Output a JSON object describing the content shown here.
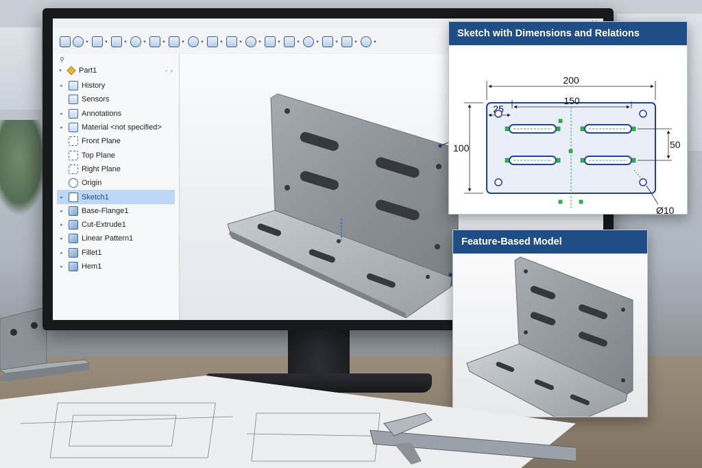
{
  "window": {
    "controls": [
      "–",
      "✕"
    ]
  },
  "toolbar": {
    "icons": [
      "home-icon",
      "new-doc-icon",
      "open-icon",
      "save-icon",
      "print-icon",
      "undo-icon",
      "rebuild-icon",
      "options-icon",
      "select-icon",
      "zoom-icon",
      "view-orient-icon",
      "display-style-icon",
      "hide-show-icon",
      "appearance-icon",
      "scene-icon",
      "section-icon",
      "measure-icon"
    ]
  },
  "feature_tree": {
    "filter_icon": "filter-icon",
    "root_label": "Part1",
    "items": [
      {
        "label": "History",
        "icon": "history-folder-icon",
        "expand": "▸",
        "kind": "folder"
      },
      {
        "label": "Sensors",
        "icon": "sensors-folder-icon",
        "expand": "",
        "kind": "folder"
      },
      {
        "label": "Annotations",
        "icon": "annotations-folder-icon",
        "expand": "▸",
        "kind": "folder"
      },
      {
        "label": "Material <not specified>",
        "icon": "material-icon",
        "expand": "▸",
        "kind": "folder"
      },
      {
        "label": "Front Plane",
        "icon": "plane-icon",
        "expand": "",
        "kind": "plane"
      },
      {
        "label": "Top Plane",
        "icon": "plane-icon",
        "expand": "",
        "kind": "plane"
      },
      {
        "label": "Right Plane",
        "icon": "plane-icon",
        "expand": "",
        "kind": "plane"
      },
      {
        "label": "Origin",
        "icon": "origin-icon",
        "expand": "",
        "kind": "origin"
      },
      {
        "label": "Sketch1",
        "icon": "sketch-icon",
        "expand": "▸",
        "kind": "sketch",
        "selected": true
      },
      {
        "label": "Base-Flange1",
        "icon": "base-flange-icon",
        "expand": "▸",
        "kind": "feature"
      },
      {
        "label": "Cut-Extrude1",
        "icon": "cut-extrude-icon",
        "expand": "▸",
        "kind": "feature"
      },
      {
        "label": "Linear Pattern1",
        "icon": "linear-pattern-icon",
        "expand": "▸",
        "kind": "feature"
      },
      {
        "label": "Fillet1",
        "icon": "fillet-icon",
        "expand": "▸",
        "kind": "feature"
      },
      {
        "label": "Hem1",
        "icon": "hem-icon",
        "expand": "▸",
        "kind": "feature"
      }
    ]
  },
  "sketch_panel": {
    "title": "Sketch with Dimensions and Relations",
    "dimensions": {
      "overall_width": "200",
      "slot_spacing": "150",
      "edge_offset": "25",
      "height": "100",
      "slot_pitch": "50",
      "hole_diameter": "Ø10"
    }
  },
  "model_panel": {
    "title": "Feature-Based Model"
  },
  "colors": {
    "panel_header": "#1f4e87",
    "sketch_line": "#1e3fb0",
    "relation_marker": "#2fb34a",
    "selection": "#bdd7f5"
  }
}
